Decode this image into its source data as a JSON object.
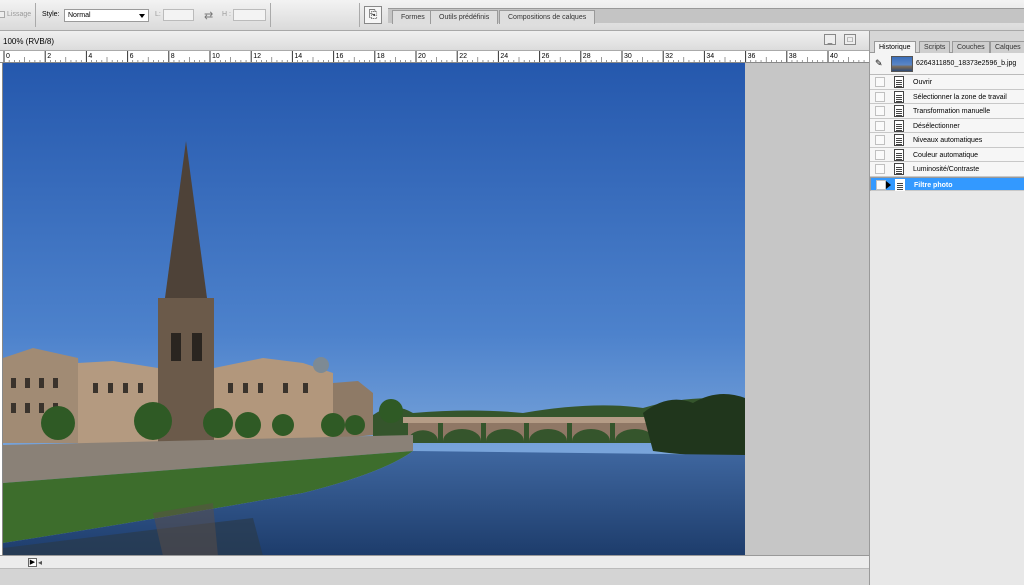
{
  "options_bar": {
    "smoothing_label": "Lissage",
    "style_label": "Style:",
    "style_value": "Normal",
    "width_label": "L:",
    "height_label": "H :",
    "tabs": [
      "Formes",
      "Outils prédéfinis",
      "Compositions de calques"
    ]
  },
  "document": {
    "title": "100% (RVB/8)",
    "ruler_ticks": [
      "0",
      "2",
      "4",
      "6",
      "8",
      "10",
      "12",
      "14",
      "16",
      "18",
      "20",
      "22",
      "24",
      "26",
      "28",
      "30",
      "32",
      "34",
      "36",
      "38",
      "40"
    ]
  },
  "history_panel": {
    "tabs": [
      "Historique",
      "Scripts",
      "Couches",
      "Calques"
    ],
    "snapshot_name": "6264311850_18373e2596_b.jpg",
    "items": [
      "Ouvrir",
      "Sélectionner la zone de travail",
      "Transformation manuelle",
      "Désélectionner",
      "Niveaux automatiques",
      "Couleur automatique",
      "Luminosité/Contraste",
      "Filtre photo"
    ],
    "selected_index": 7
  },
  "colors": {
    "selection": "#3399ff",
    "sky_top": "#2a5fb4",
    "sky_bottom": "#6f9bd6",
    "water": "#2d5286"
  }
}
